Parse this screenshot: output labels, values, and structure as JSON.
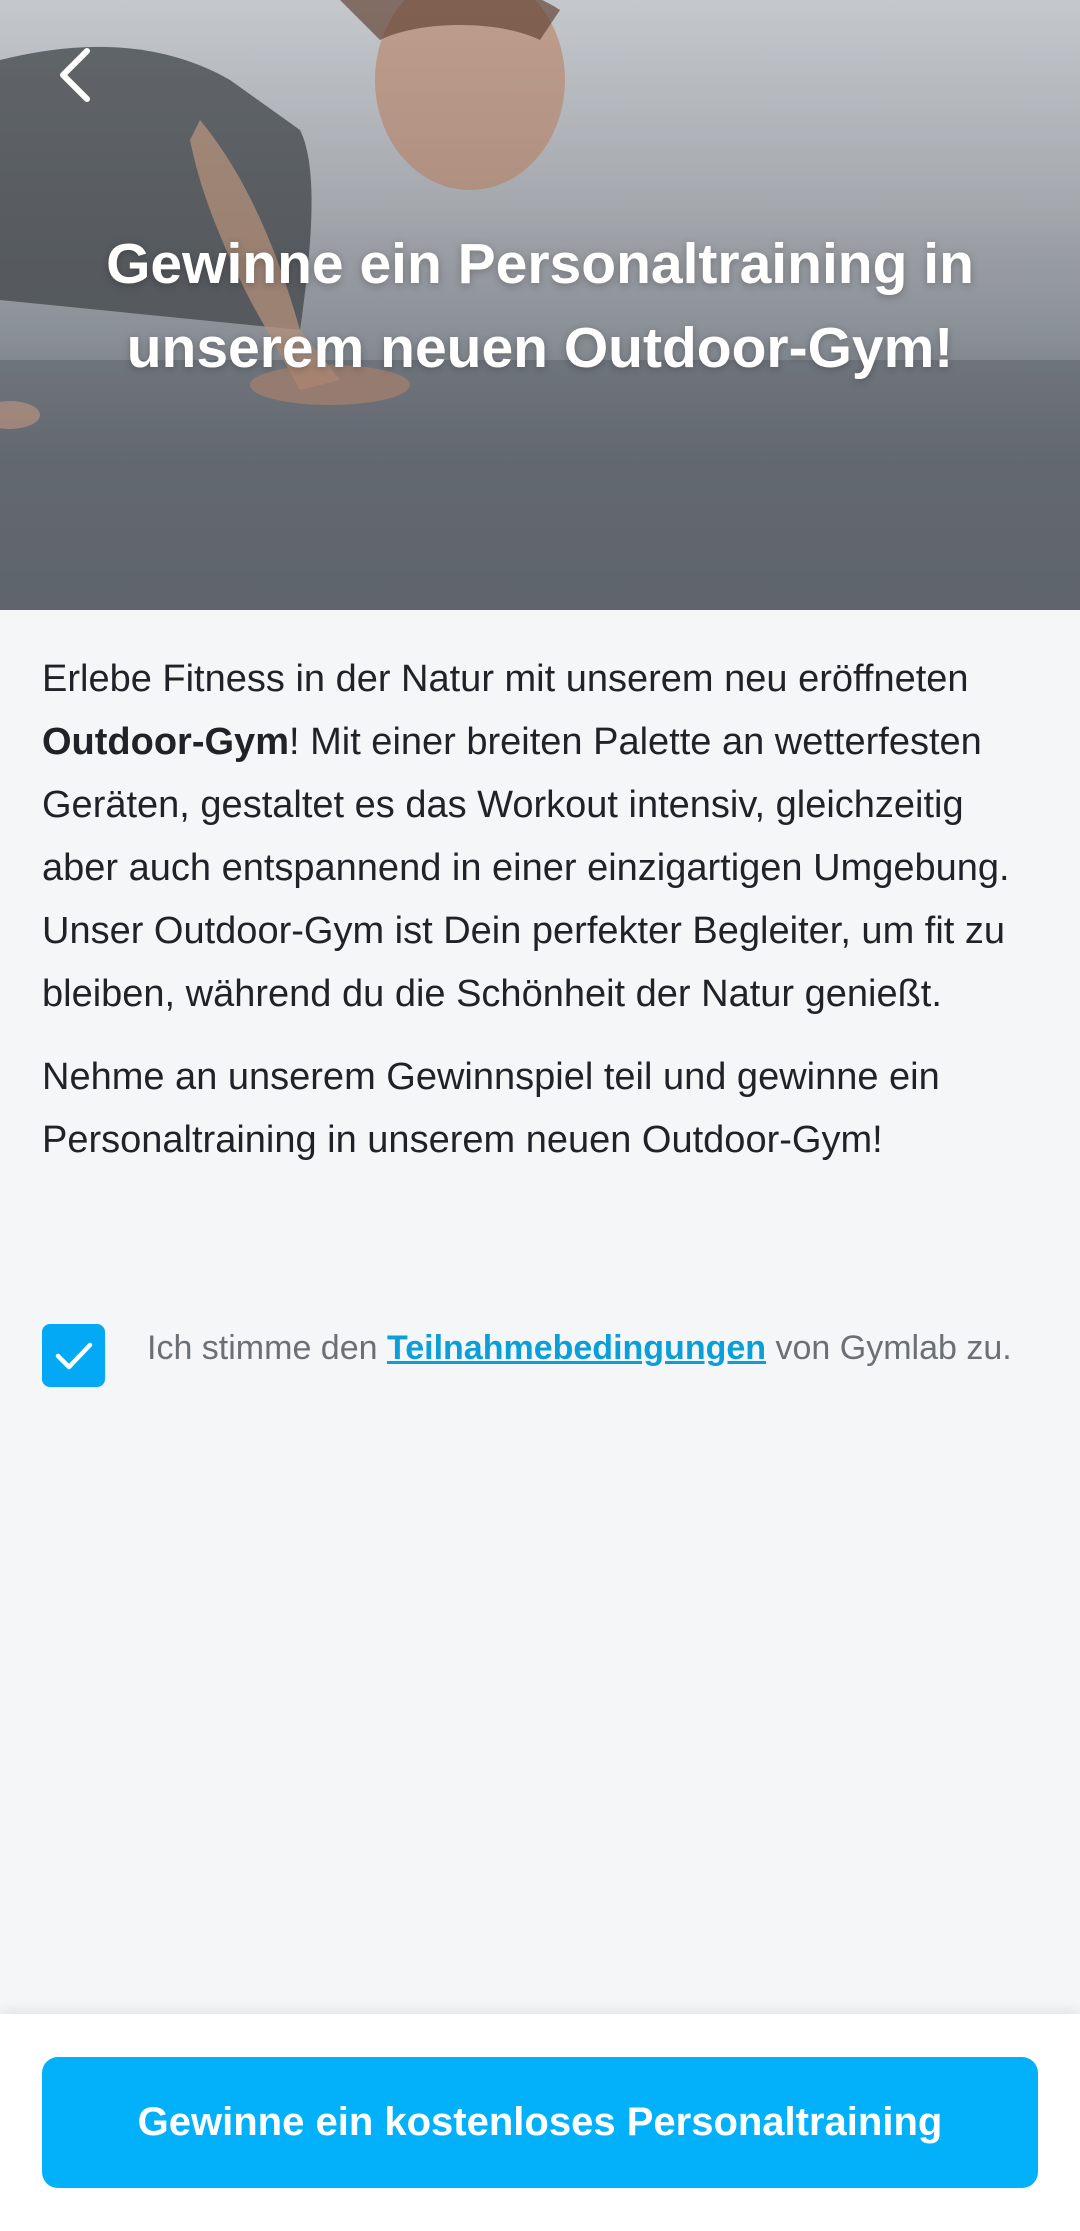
{
  "hero": {
    "title": "Gewinne ein Personaltraining in unserem neuen Outdoor-Gym!",
    "back_icon": "chevron-left-icon"
  },
  "body": {
    "paragraph1_before": "Erlebe Fitness in der Natur mit unserem neu eröffneten ",
    "paragraph1_bold": "Outdoor-Gym",
    "paragraph1_after": "! Mit einer breiten Palette an wetterfesten Geräten, gestaltet es das Workout intensiv, gleichzeitig aber auch entspannend in einer einzigartigen Umgebung. Unser Outdoor-Gym ist Dein perfekter Begleiter, um fit zu bleiben, während du die Schönheit der Natur genießt.",
    "paragraph2": "Nehme an unserem Gewinnspiel teil und gewinne ein Personaltraining in unserem neuen Outdoor-Gym!"
  },
  "consent": {
    "checked": true,
    "text_before": "Ich stimme den ",
    "link_text": "Teilnahmebedingungen",
    "text_after": " von Gymlab zu."
  },
  "cta": {
    "label": "Gewinne ein kostenloses Personaltraining"
  },
  "colors": {
    "accent": "#03b1fb",
    "checkbox": "#03a9f4",
    "link": "#0a9fd8",
    "background": "#f5f6f8"
  }
}
